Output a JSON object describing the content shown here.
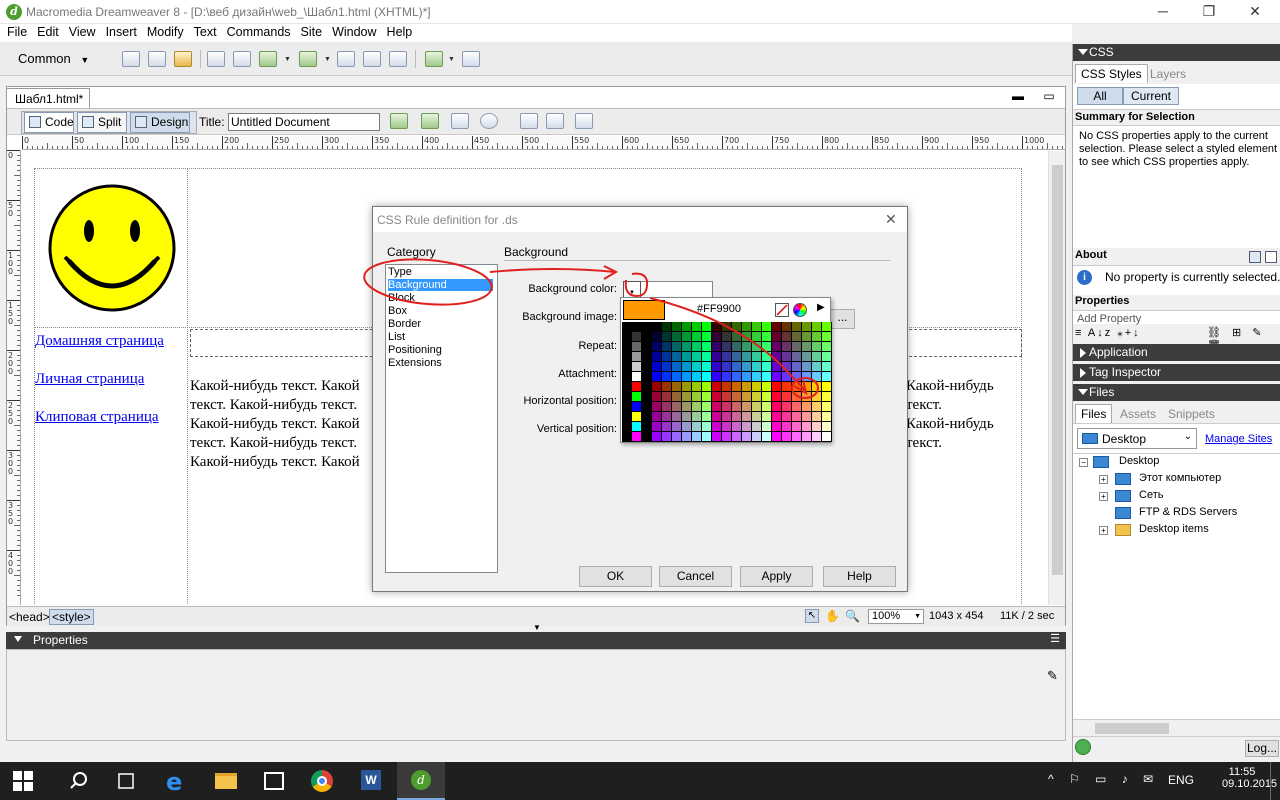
{
  "window": {
    "title": "Macromedia Dreamweaver 8 - [D:\\веб дизайн\\web_\\Шабл1.html (XHTML)*]",
    "app_icon_letter": "d"
  },
  "menu": [
    "File",
    "Edit",
    "View",
    "Insert",
    "Modify",
    "Text",
    "Commands",
    "Site",
    "Window",
    "Help"
  ],
  "insertbar": {
    "category": "Common"
  },
  "document": {
    "tab": "Шабл1.html*",
    "views": [
      "Code",
      "Split",
      "Design"
    ],
    "title_label": "Title:",
    "title_value": "Untitled Document",
    "ruler_h": [
      "0",
      "50",
      "100",
      "150",
      "200",
      "250",
      "300",
      "350",
      "400",
      "450",
      "500",
      "550",
      "600",
      "650",
      "700",
      "750",
      "800",
      "850",
      "900",
      "950",
      "1000"
    ],
    "ruler_v": [
      "0",
      "5\n0",
      "1\n0\n0",
      "1\n5\n0",
      "2\n0\n0",
      "2\n5\n0",
      "3\n0\n0",
      "3\n5\n0",
      "4\n0\n0"
    ],
    "links": [
      "Домашняя страница",
      "Личная страница",
      "Клиповая страница"
    ],
    "left_text_lines": [
      "Какой-нибудь текст. Какой",
      "текст. Какой-нибудь текст.",
      "Какой-нибудь текст. Какой",
      "текст. Какой-нибудь текст.",
      "Какой-нибудь текст. Какой"
    ],
    "right_text_lines": [
      "Какой-нибудь",
      "текст.",
      "Какой-нибудь",
      "текст."
    ]
  },
  "status": {
    "tags": [
      "<head>",
      "<style>"
    ],
    "zoom": "100%",
    "size": "1043 x 454",
    "weight": "11K / 2 sec"
  },
  "properties_panel": {
    "title": "Properties"
  },
  "right_panel": {
    "css_header": "CSS",
    "css_tabs": [
      "CSS Styles",
      "Layers"
    ],
    "css_modes": [
      "All",
      "Current"
    ],
    "summary_title": "Summary for Selection",
    "summary_text": "No CSS properties apply to the current selection.  Please select a styled element to see which CSS properties apply.",
    "about_title": "About",
    "about_text": "No property is currently selected...",
    "properties_title": "Properties",
    "add_property": "Add Property",
    "application": "Application",
    "tag_inspector": "Tag Inspector",
    "files_header": "Files",
    "files_tabs": [
      "Files",
      "Assets",
      "Snippets"
    ],
    "site_select": "Desktop",
    "manage_sites": "Manage Sites",
    "tree": [
      {
        "label": "Desktop",
        "level": 0,
        "expander": "−"
      },
      {
        "label": "Этот компьютер",
        "level": 1,
        "expander": "+"
      },
      {
        "label": "Сеть",
        "level": 1,
        "expander": "+"
      },
      {
        "label": "FTP & RDS Servers",
        "level": 1,
        "expander": ""
      },
      {
        "label": "Desktop items",
        "level": 1,
        "expander": "+"
      }
    ],
    "log_button": "Log..."
  },
  "dialog": {
    "title": "CSS Rule definition for .ds",
    "category_label": "Category",
    "section_label": "Background",
    "categories": [
      "Type",
      "Background",
      "Block",
      "Box",
      "Border",
      "List",
      "Positioning",
      "Extensions"
    ],
    "selected_category": "Background",
    "fields": [
      "Background color:",
      "Background image:",
      "Repeat:",
      "Attachment:",
      "Horizontal position:",
      "Vertical position:"
    ],
    "buttons": [
      "OK",
      "Cancel",
      "Apply",
      "Help"
    ],
    "browse": "...",
    "picker": {
      "hex": "#FF9900",
      "preview_color": "#ff9900"
    }
  },
  "taskbar": {
    "lang": "ENG",
    "time": "11:55",
    "date": "09.10.2015"
  },
  "colors": {
    "annotation": "#e0201e",
    "selection": "#3399ff",
    "smiley": "#ffff00"
  }
}
